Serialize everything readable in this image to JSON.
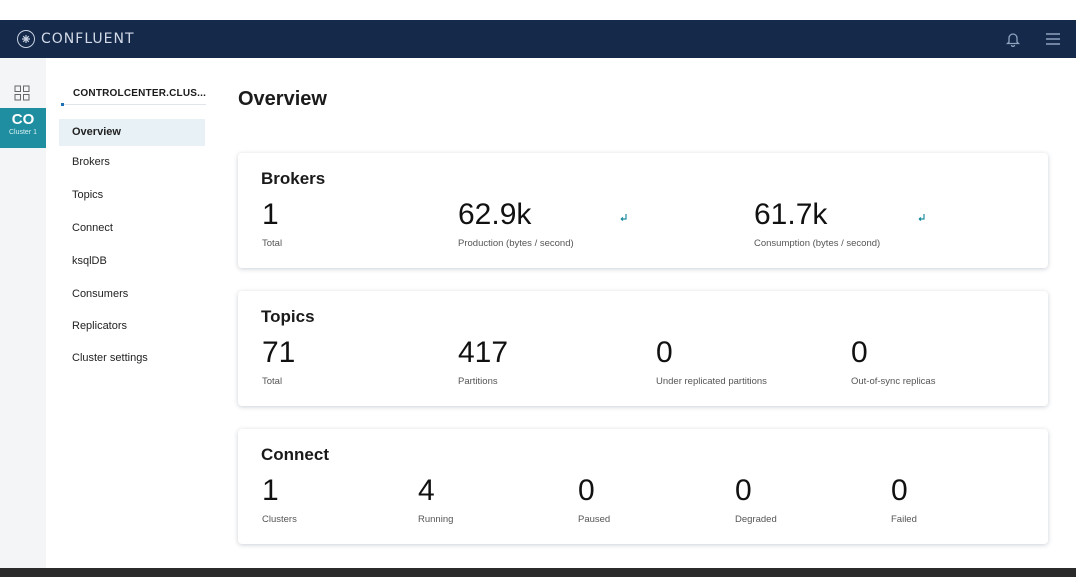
{
  "app": {
    "brand": "CONFLUENT"
  },
  "rail": {
    "cluster_abbr": "CO",
    "cluster_sub": "Cluster 1"
  },
  "sidebar": {
    "cluster_name": "CONTROLCENTER.CLUS...",
    "items": [
      {
        "label": "Overview",
        "active": true
      },
      {
        "label": "Brokers"
      },
      {
        "label": "Topics"
      },
      {
        "label": "Connect"
      },
      {
        "label": "ksqlDB"
      },
      {
        "label": "Consumers"
      },
      {
        "label": "Replicators"
      },
      {
        "label": "Cluster settings"
      }
    ]
  },
  "main": {
    "title": "Overview",
    "brokers": {
      "title": "Brokers",
      "total_value": "1",
      "total_label": "Total",
      "production_value": "62.9k",
      "production_label": "Production (bytes / second)",
      "consumption_value": "61.7k",
      "consumption_label": "Consumption (bytes / second)"
    },
    "topics": {
      "title": "Topics",
      "total_value": "71",
      "total_label": "Total",
      "partitions_value": "417",
      "partitions_label": "Partitions",
      "under_value": "0",
      "under_label": "Under replicated partitions",
      "outofsync_value": "0",
      "outofsync_label": "Out-of-sync replicas"
    },
    "connect": {
      "title": "Connect",
      "clusters_value": "1",
      "clusters_label": "Clusters",
      "running_value": "4",
      "running_label": "Running",
      "paused_value": "0",
      "paused_label": "Paused",
      "degraded_value": "0",
      "degraded_label": "Degraded",
      "failed_value": "0",
      "failed_label": "Failed"
    }
  },
  "colors": {
    "topbar": "#15294a",
    "accent": "#1f8ea0"
  },
  "icons": {
    "brand": "confluent-logo-icon",
    "bell": "bell-icon",
    "menu": "hamburger-menu-icon",
    "grid": "grid-icon",
    "trend": "trend-arrow-icon"
  }
}
